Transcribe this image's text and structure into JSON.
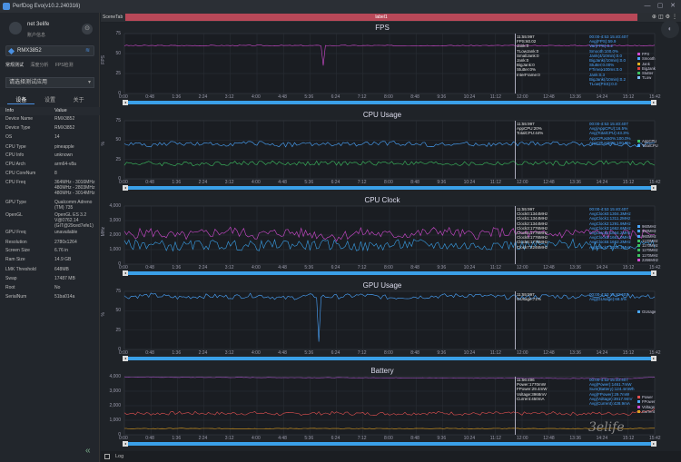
{
  "app": {
    "title": "PerfDog Evo(v10.2.240316)",
    "controls": [
      "—",
      "▢",
      "✕"
    ]
  },
  "user": {
    "name": "net 3elife",
    "sub": "账户信息",
    "btn": "⊙"
  },
  "device": {
    "name": "RMX3852"
  },
  "modes": [
    "常规测试",
    "深度分析",
    "FPS检测"
  ],
  "appselect": {
    "placeholder": "请选择测试应用"
  },
  "tabs": [
    "设备",
    "设置",
    "关于"
  ],
  "info": {
    "header": {
      "k": "Info",
      "v": "Value"
    },
    "rows": [
      {
        "k": "Device Name",
        "v": "RMX3852"
      },
      {
        "k": "Device Type",
        "v": "RMX3852"
      },
      {
        "k": "OS",
        "v": "14"
      },
      {
        "k": "CPU Type",
        "v": "pineapple"
      },
      {
        "k": "CPU Info",
        "v": "unknown"
      },
      {
        "k": "CPU Arch",
        "v": "arm64-v8a"
      },
      {
        "k": "CPU CoreNum",
        "v": "8"
      },
      {
        "k": "CPU Freq",
        "v": "364MHz - 3016MHz 480MHz - 2803MHz 480MHz - 3014MHz"
      },
      {
        "k": "GPU Type",
        "v": "Qualcomm Adreno (TM) 735"
      },
      {
        "k": "OpenGL",
        "v": "OpenGL ES 3.2 V@0762.14 (GIT@29ced7efe1)"
      },
      {
        "k": "GPU Freq",
        "v": "unavailable"
      },
      {
        "k": "Resolution",
        "v": "2780x1264"
      },
      {
        "k": "Screen Size",
        "v": "6.76 in"
      },
      {
        "k": "Ram Size",
        "v": "14.9 GB"
      },
      {
        "k": "LMK Threshold",
        "v": "648MB"
      },
      {
        "k": "Swap",
        "v": "17487 MB"
      },
      {
        "k": "Root",
        "v": "No"
      },
      {
        "k": "SerialNum",
        "v": "51ba014a"
      }
    ]
  },
  "topbar": {
    "scenetab": "SceneTab",
    "label": "label1",
    "icons": "⊕◫⚙⋮"
  },
  "xticks": [
    "0:00",
    "0:48",
    "1:36",
    "2:24",
    "3:12",
    "4:00",
    "4:48",
    "5:36",
    "6:24",
    "7:12",
    "8:00",
    "8:48",
    "9:36",
    "10:24",
    "11:12",
    "12:00",
    "12:48",
    "13:36",
    "14:24",
    "15:12",
    "15:42"
  ],
  "panels": [
    {
      "key": "fps",
      "title": "FPS",
      "ylabel": "FPS",
      "yticks": [
        "75",
        "50",
        "25",
        "0"
      ],
      "overlay_white": [
        "11:55:997",
        "FPS:60.02",
        "Jank:0",
        "TLowJank:0",
        "SmallJank:0",
        "Jank:0",
        "BigJank:0",
        "Stutter:0%",
        "InterFrame:0"
      ],
      "overlay_blue": [
        "00:00-4:53 15:40:407",
        "Avg(FPS):59.9",
        "Var(FPS):0.2",
        "Smooth:100.0%",
        "Jank(4/10min):0.0",
        "BigJank(/10min):0.0",
        "Stutter:0.00%",
        "FTime≥100ms:0.0",
        "Jank:0.3",
        "BigJank(/10min):0.2",
        "TLow(PSS):0.0"
      ],
      "legend": [
        {
          "n": "FPS",
          "c": "#d04ad0"
        },
        {
          "n": "Smooth",
          "c": "#4aa6ff"
        },
        {
          "n": "Jank",
          "c": "#e0b020"
        },
        {
          "n": "BigJank",
          "c": "#e04040"
        },
        {
          "n": "Stutter",
          "c": "#3cc060"
        },
        {
          "n": "TLow",
          "c": "#7fbfff"
        }
      ],
      "chart_data": {
        "type": "line",
        "xlabel": "",
        "ylabel": "FPS",
        "ylim": [
          0,
          75
        ],
        "series": [
          {
            "name": "FPS",
            "values": [
              60,
              60,
              60,
              60,
              60,
              60,
              60,
              60,
              60,
              60,
              60,
              60,
              60,
              60,
              60,
              60,
              60,
              60,
              60,
              60,
              60
            ]
          }
        ]
      }
    },
    {
      "key": "cpu",
      "title": "CPU Usage",
      "ylabel": "%",
      "yticks": [
        "75",
        "50",
        "25",
        "0"
      ],
      "overlay_white": [
        "11:55:997",
        "AppCPU:20%",
        "TotalCPU:44%"
      ],
      "overlay_blue": [
        "00:00-4:53 15:40:407",
        "Avg(AppCPU):16.5%",
        "Avg(TotalCPU):43.3%",
        "AppCPU≤60%:100.0%",
        "AppCPU≤80%:100.0%"
      ],
      "legend": [
        {
          "n": "AppCPU",
          "c": "#3cc060"
        },
        {
          "n": "TotalCPU",
          "c": "#4aa6ff"
        }
      ],
      "chart_data": {
        "type": "line",
        "xlabel": "",
        "ylabel": "%",
        "ylim": [
          0,
          75
        ],
        "series": [
          {
            "name": "AppCPU",
            "values": [
              20,
              20,
              19,
              20,
              20,
              21,
              20,
              20,
              20,
              20,
              21,
              20,
              20,
              19,
              20,
              20,
              20,
              20,
              21,
              20,
              20
            ]
          },
          {
            "name": "TotalCPU",
            "values": [
              45,
              44,
              46,
              44,
              45,
              46,
              44,
              45,
              44,
              45,
              46,
              45,
              44,
              45,
              44,
              45,
              46,
              45,
              44,
              44,
              44
            ]
          }
        ]
      }
    },
    {
      "key": "clock",
      "title": "CPU Clock",
      "ylabel": "MHz",
      "yticks": [
        "4,000",
        "3,000",
        "2,000",
        "1,000",
        "0"
      ],
      "overlay_white": [
        "11:55:997",
        "Clock0:1344MHz",
        "Clock1:1344MHz",
        "Clock2:1344MHz",
        "Clock3:1776MHz",
        "Clock4:1776MHz",
        "Clock5:1776MHz",
        "Clock6:1776MHz",
        "Clock7:2246MHz"
      ],
      "overlay_blue": [
        "00:00-4:53 15:40:407",
        "AvgClock0:1304.3MHz",
        "AvgClock1:1311.2MHz",
        "AvgClock2:1291.9MHz",
        "AvgClock3:1662.6MHz",
        "AvgClock4:1664.2MHz",
        "AvgClock5:1661.0MHz",
        "AvgClock6:1662.2MHz",
        "AvgClock7:2025.1MHz"
      ],
      "legend": [
        {
          "n": "960MHz",
          "c": "#4aa6ff"
        },
        {
          "n": "960MHz",
          "c": "#4aa6ff"
        },
        {
          "n": "960MHz",
          "c": "#4aa6ff"
        },
        {
          "n": "1170MHz",
          "c": "#3cc060"
        },
        {
          "n": "1170MHz",
          "c": "#3cc060"
        },
        {
          "n": "1170MHz",
          "c": "#3cc060"
        },
        {
          "n": "1170MHz",
          "c": "#3cc060"
        },
        {
          "n": "2266MHz",
          "c": "#d04ad0"
        }
      ],
      "chart_data": {
        "type": "line",
        "xlabel": "",
        "ylabel": "MHz",
        "ylim": [
          0,
          4000
        ],
        "series": [
          {
            "name": "Clock7",
            "values": [
              2000,
              2200,
              1900,
              2100,
              2300,
              2000,
              2200,
              2100,
              1900,
              2200,
              2000,
              2100,
              2300,
              2000,
              2200,
              2100,
              2000,
              2200,
              2100,
              2000,
              2200
            ]
          },
          {
            "name": "Clock0",
            "values": [
              1300,
              1400,
              1200,
              1350,
              1300,
              1250,
              1400,
              1300,
              1350,
              1200,
              1300,
              1400,
              1300,
              1250,
              1350,
              1300,
              1300,
              1400,
              1250,
              1300,
              1300
            ]
          }
        ]
      }
    },
    {
      "key": "gpu",
      "title": "GPU Usage",
      "ylabel": "%",
      "yticks": [
        "75",
        "50",
        "25",
        "0"
      ],
      "overlay_white": [
        "11:55:997",
        "GUsage:71%"
      ],
      "overlay_blue": [
        "00:00-4:53 15:40:407",
        "Avg(GUsage):68.5%"
      ],
      "legend": [
        {
          "n": "GUsage",
          "c": "#4aa6ff"
        }
      ],
      "chart_data": {
        "type": "line",
        "xlabel": "",
        "ylabel": "%",
        "ylim": [
          0,
          75
        ],
        "series": [
          {
            "name": "GUsage",
            "values": [
              68,
              70,
              67,
              69,
              68,
              70,
              66,
              69,
              68,
              70,
              67,
              68,
              69,
              70,
              68,
              67,
              69,
              68,
              70,
              69,
              68
            ]
          }
        ]
      }
    },
    {
      "key": "battery",
      "title": "Battery",
      "ylabel": "",
      "yticks": [
        "4,000",
        "3,000",
        "2,000",
        "1,000",
        "0"
      ],
      "overlay_white": [
        "11:56:496",
        "Power:1770mW",
        "FPower:29.4mW",
        "Voltage:3968mV",
        "Current:450mA"
      ],
      "overlay_blue": [
        "00:00-4:53 15:40:407",
        "Avg(Power):1461.7mW",
        "Sum(Battery):124.4mWh",
        "Avg(FPower):29.7mW",
        "Avg(Voltage):3917.9mV",
        "Avg(Current):428.9mA"
      ],
      "legend": [
        {
          "n": "Power",
          "c": "#e05050"
        },
        {
          "n": "FPower",
          "c": "#4aa6ff"
        },
        {
          "n": "Voltage",
          "c": "#d04ad0"
        },
        {
          "n": "Current",
          "c": "#e0a020"
        }
      ],
      "chart_data": {
        "type": "line",
        "xlabel": "",
        "ylabel": "",
        "ylim": [
          0,
          4000
        ],
        "series": [
          {
            "name": "Power",
            "values": [
              1500,
              1450,
              1500,
              1480,
              1460,
              1500,
              1420,
              1470,
              1490,
              1450,
              1460,
              1480,
              1500,
              1440,
              1470,
              1460,
              1480,
              1450,
              1470,
              1460,
              1770
            ]
          },
          {
            "name": "Voltage",
            "values": [
              3980,
              3970,
              3960,
              3950,
              3950,
              3940,
              3940,
              3930,
              3930,
              3920,
              3920,
              3910,
              3910,
              3900,
              3900,
              3890,
              3890,
              3880,
              3880,
              3870,
              3968
            ]
          },
          {
            "name": "Current",
            "values": [
              430,
              420,
              440,
              425,
              430,
              420,
              430,
              435,
              420,
              430,
              425,
              430,
              440,
              420,
              430,
              430,
              425,
              420,
              430,
              430,
              450
            ]
          }
        ]
      }
    }
  ],
  "bottom": {
    "log": "Log"
  },
  "watermark": "3elife"
}
